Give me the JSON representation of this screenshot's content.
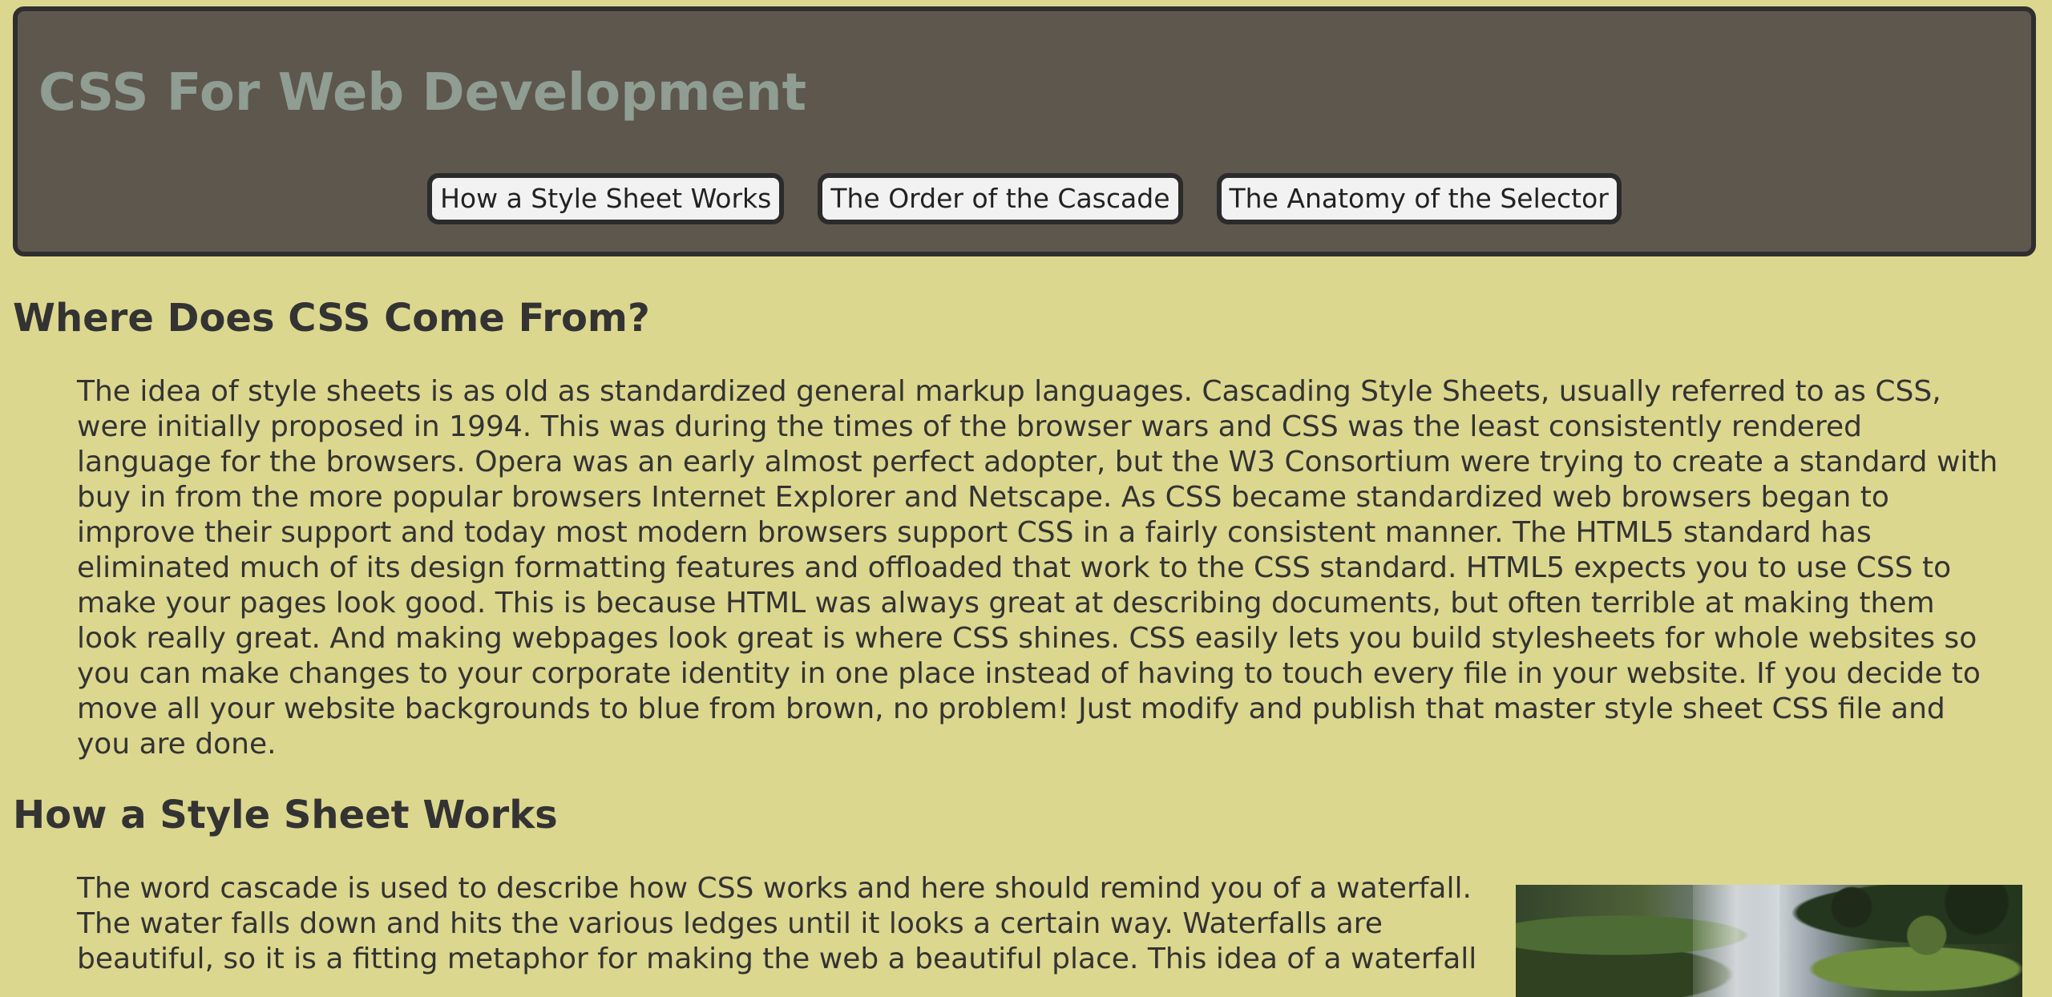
{
  "colors": {
    "page_background": "#dcd78e",
    "header_background": "#5e574e",
    "header_border": "#2f2f2f",
    "title_color": "#8f9d92",
    "text_color": "#333333",
    "button_background": "#f2f2f2"
  },
  "header": {
    "title": "CSS For Web Development",
    "nav_buttons": [
      "How a Style Sheet Works",
      "The Order of the Cascade",
      "The Anatomy of the Selector"
    ]
  },
  "sections": [
    {
      "heading": "Where Does CSS Come From?",
      "paragraph": "The idea of style sheets is as old as standardized general markup languages. Cascading Style Sheets, usually referred to as CSS, were initially proposed in 1994. This was during the times of the browser wars and CSS was the least consistently rendered language for the browsers. Opera was an early almost perfect adopter, but the W3 Consortium were trying to create a standard with buy in from the more popular browsers Internet Explorer and Netscape. As CSS became standardized web browsers began to improve their support and today most modern browsers support CSS in a fairly consistent manner. The HTML5 standard has eliminated much of its design formatting features and offloaded that work to the CSS standard. HTML5 expects you to use CSS to make your pages look good. This is because HTML was always great at describing documents, but often terrible at making them look really great. And making webpages look great is where CSS shines. CSS easily lets you build stylesheets for whole websites so you can make changes to your corporate identity in one place instead of having to touch every file in your website. If you decide to move all your website backgrounds to blue from brown, no problem! Just modify and publish that master style sheet CSS file and you are done."
    },
    {
      "heading": "How a Style Sheet Works",
      "paragraph": "The word cascade is used to describe how CSS works and here should remind you of a waterfall. The water falls down and hits the various ledges until it looks a certain way. Waterfalls are beautiful, so it is a fitting metaphor for making the web a beautiful place. This idea of a waterfall"
    }
  ]
}
